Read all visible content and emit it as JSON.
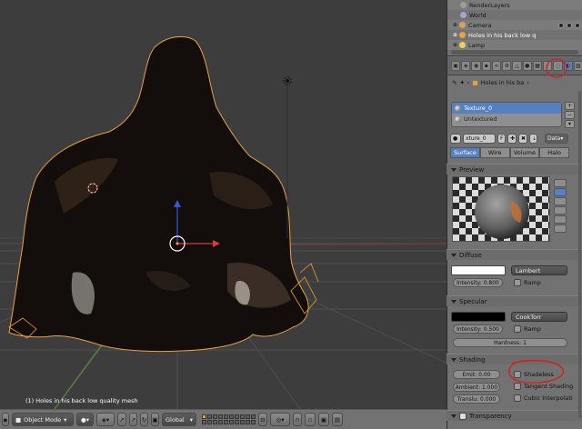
{
  "viewport": {
    "info_text": "(1) Holes in his back low quality mesh"
  },
  "header": {
    "mode_label": "Object Mode",
    "orientation_label": "Global"
  },
  "outliner": {
    "items": [
      {
        "label": "RenderLayers"
      },
      {
        "label": "World"
      },
      {
        "label": "Camera"
      },
      {
        "label": "Holes in his back low q"
      },
      {
        "label": "Lamp"
      }
    ]
  },
  "properties": {
    "breadcrumb_object": "Holes in his ba",
    "slots": [
      {
        "label": "Texture_0"
      },
      {
        "label": "Untextured"
      }
    ],
    "material_name": "xture_0",
    "material_users": "F",
    "data_label": "Data",
    "type_tabs": [
      "Surface",
      "Wire",
      "Volume",
      "Halo"
    ],
    "preview_header": "Preview",
    "diffuse": {
      "header": "Diffuse",
      "shader": "Lambert",
      "intensity": "Intensity: 0.800",
      "ramp": "Ramp",
      "color": "#ffffff"
    },
    "specular": {
      "header": "Specular",
      "shader": "CookTorr",
      "intensity": "Intensity: 0.500",
      "ramp": "Ramp",
      "hardness": "Hardness: 1",
      "color": "#000000"
    },
    "shading": {
      "header": "Shading",
      "emit": "Emit: 0.00",
      "ambient": "Ambient: 1.000",
      "translucency": "Translu: 0.000",
      "shadeless": "Shadeless",
      "tangent": "Tangent Shading",
      "cubic": "Cubic Interpolati"
    },
    "transparency_header": "Transparency"
  },
  "colors": {
    "selection_orange": "#e8a33c",
    "annotation_red": "#e01818",
    "active_blue": "#5680c2"
  }
}
